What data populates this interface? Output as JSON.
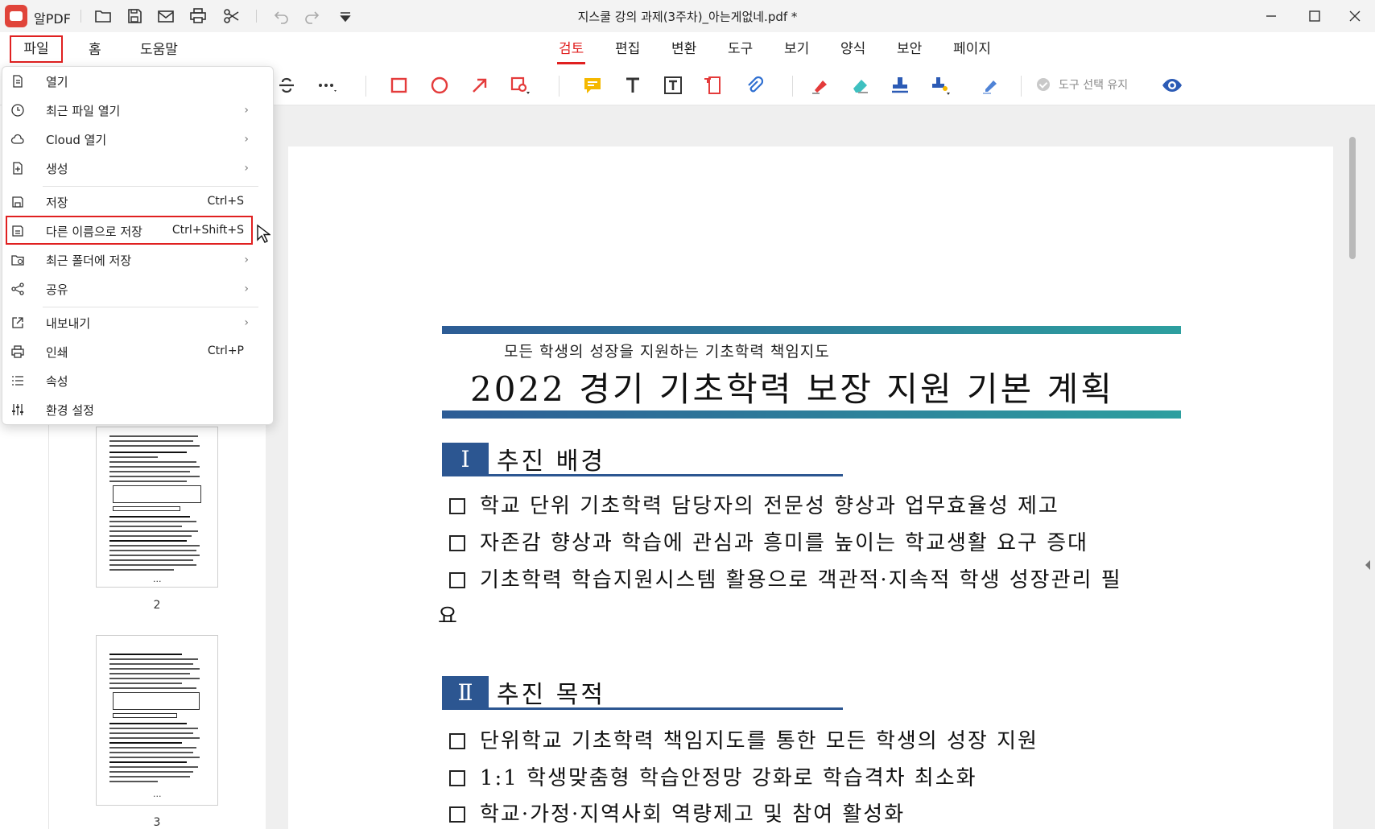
{
  "app": {
    "name": "알PDF",
    "document_title": "지스쿨 강의 과제(3주차)_아는게없네.pdf *"
  },
  "menu": {
    "file": "파일",
    "home": "홈",
    "help": "도움말"
  },
  "tabs": [
    "검토",
    "편집",
    "변환",
    "도구",
    "보기",
    "양식",
    "보안",
    "페이지"
  ],
  "active_tab": "검토",
  "toolbar": {
    "keep_tool_label": "도구 선택 유지"
  },
  "file_menu": {
    "items": [
      {
        "label": "열기",
        "shortcut": "",
        "submenu": false
      },
      {
        "label": "최근 파일 열기",
        "shortcut": "",
        "submenu": true
      },
      {
        "label": "Cloud 열기",
        "shortcut": "",
        "submenu": true
      },
      {
        "label": "생성",
        "shortcut": "",
        "submenu": true
      },
      {
        "label": "저장",
        "shortcut": "Ctrl+S",
        "submenu": false
      },
      {
        "label": "다른 이름으로 저장",
        "shortcut": "Ctrl+Shift+S",
        "submenu": false
      },
      {
        "label": "최근 폴더에 저장",
        "shortcut": "",
        "submenu": true
      },
      {
        "label": "공유",
        "shortcut": "",
        "submenu": true
      },
      {
        "label": "내보내기",
        "shortcut": "",
        "submenu": true
      },
      {
        "label": "인쇄",
        "shortcut": "Ctrl+P",
        "submenu": false
      },
      {
        "label": "속성",
        "shortcut": "",
        "submenu": false
      },
      {
        "label": "환경 설정",
        "shortcut": "",
        "submenu": false
      }
    ],
    "submenu_arrow": "›"
  },
  "thumbnails": {
    "pages": [
      {
        "number": "2",
        "ellipsis": "..."
      },
      {
        "number": "3",
        "ellipsis": "..."
      }
    ]
  },
  "document": {
    "subtitle": "모든 학생의 성장을 지원하는 기초학력 책임지도",
    "title": "2022 경기 기초학력 보장 지원 기본 계획",
    "sections": [
      {
        "numeral": "Ⅰ",
        "heading": "추진 배경",
        "bullets": [
          "학교 단위 기초학력 담당자의 전문성 향상과 업무효율성 제고",
          "자존감 향상과 학습에 관심과 흥미를 높이는 학교생활 요구 증대",
          "기초학력 학습지원시스템 활용으로 객관적·지속적 학생 성장관리 필"
        ],
        "wrap_tail": "요"
      },
      {
        "numeral": "Ⅱ",
        "heading": "추진 목적",
        "bullets": [
          "단위학교 기초학력 책임지도를 통한 모든 학생의 성장 지원",
          "1:1 학생맞춤형 학습안정망 강화로 학습격차 최소화",
          "학교·가정·지역사회 역량제고 및 참여 활성화"
        ]
      }
    ]
  },
  "colors": {
    "accent": "#e02020",
    "section_blue": "#2c5691",
    "bar_start": "#2d5c95",
    "bar_end": "#2d9f9f"
  }
}
